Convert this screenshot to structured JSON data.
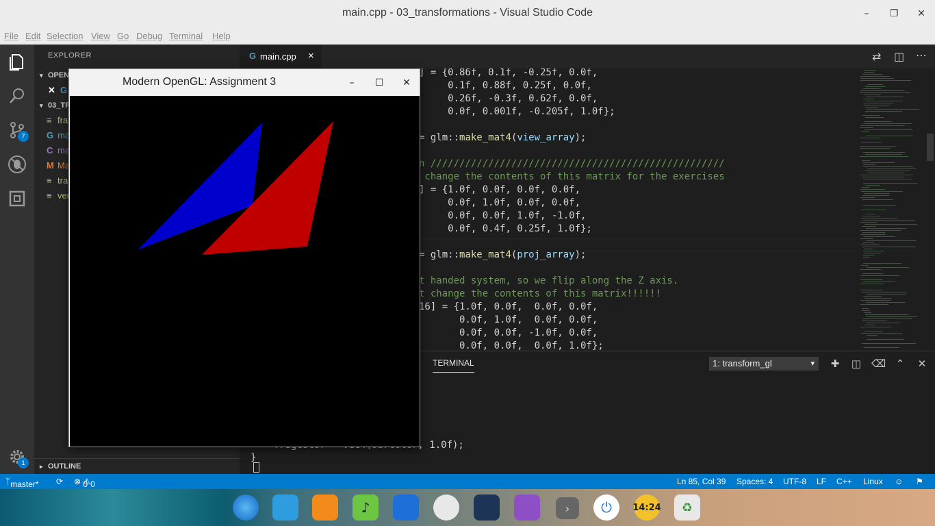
{
  "window": {
    "title": "main.cpp - 03_transformations - Visual Studio Code"
  },
  "menu": [
    "File",
    "Edit",
    "Selection",
    "View",
    "Go",
    "Debug",
    "Terminal",
    "Help"
  ],
  "activity": {
    "scm_badge": "7",
    "settings_badge": "1"
  },
  "sidebar": {
    "header": "EXPLORER",
    "open_editors_label": "OPEN",
    "folder_label": "03_TR",
    "files": [
      {
        "icon": "≡",
        "name": "fra",
        "color": "#a6c46a"
      },
      {
        "icon": "G",
        "name": "ma",
        "color": "#519aba"
      },
      {
        "icon": "C",
        "name": "ma",
        "color": "#a074c4"
      },
      {
        "icon": "M",
        "name": "Ma",
        "color": "#e37933"
      },
      {
        "icon": "≡",
        "name": "tra",
        "color": "#a6c46a"
      },
      {
        "icon": "≡",
        "name": "ver",
        "color": "#a6c46a"
      }
    ],
    "outline_label": "OUTLINE"
  },
  "tab": {
    "label": "main.cpp",
    "close": "×"
  },
  "code": {
    "l1": "] = {0.86f, 0.1f, -0.25f, 0.0f,",
    "l2": "     0.1f, 0.88f, 0.25f, 0.0f,",
    "l3": "     0.26f, -0.3f, 0.62f, 0.0f,",
    "l4": "     0.0f, 0.001f, -0.205f, 1.0f};",
    "l5a": "= glm::",
    "l5b": "make_mat4",
    "l5c": "(",
    "l5d": "view_array",
    "l5e": ");",
    "l6": "n ///////////////////////////////////////////////////",
    "l7": " change the contents of this matrix for the exercises",
    "l8": "] = {1.0f, 0.0f, 0.0f, 0.0f,",
    "l9": "     0.0f, 1.0f, 0.0f, 0.0f,",
    "l10": "     0.0f, 0.0f, 1.0f, -1.0f,",
    "l11": "     0.0f, 0.4f, 0.25f, 1.0f};",
    "l12a": "= glm::",
    "l12b": "make_mat4",
    "l12c": "(",
    "l12d": "proj_array",
    "l12e": ");",
    "l13": "t handed system, so we flip along the Z axis.",
    "l14": "t change the contents of this matrix!!!!!!",
    "l15": "16] = {1.0f, 0.0f,  0.0f, 0.0f,",
    "l16": "       0.0f, 1.0f,  0.0f, 0.0f,",
    "l17": "       0.0f, 0.0f, -1.0f, 0.0f,",
    "l18": "       0.0f, 0.0f,  0.0f, 1.0f};",
    "below1": "    fragColor = vec4(ourColor, 1.0f);",
    "below2": "}"
  },
  "panel": {
    "tab": "TERMINAL",
    "terminal_select": "1: transform_gl",
    "dropdown": "▾"
  },
  "status": {
    "branch": "master*",
    "errors": "0",
    "warnings": "0",
    "position": "Ln 85, Col 39",
    "spaces": "Spaces: 4",
    "encoding": "UTF-8",
    "eol": "LF",
    "language": "C++",
    "platform": "Linux"
  },
  "glwindow": {
    "title": "Modern OpenGL: Assignment 3",
    "blue": "#0000cc",
    "red": "#c00000"
  },
  "taskbar": {
    "clock": "14:24"
  },
  "colors": {
    "accent": "#007acc",
    "editor_bg": "#1e1e1e",
    "comment": "#6a9955"
  }
}
